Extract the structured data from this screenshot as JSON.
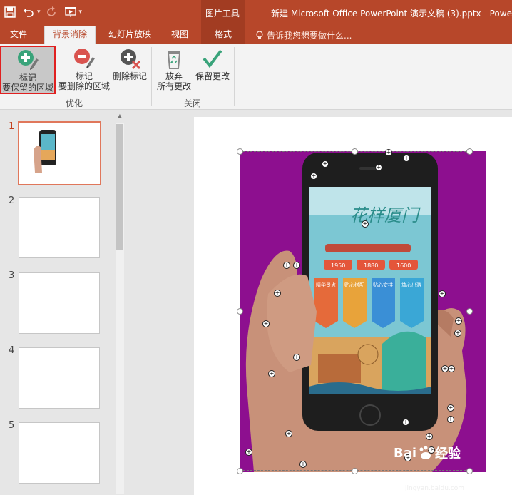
{
  "titlebar": {
    "context_group": "图片工具",
    "document_title": "新建 Microsoft Office PowerPoint 演示文稿 (3).pptx - Powe"
  },
  "tabs": [
    {
      "label": "文件"
    },
    {
      "label": "背景消除"
    },
    {
      "label": "幻灯片放映"
    },
    {
      "label": "视图"
    },
    {
      "label": "格式"
    }
  ],
  "tell_me": "告诉我您想要做什么...",
  "ribbon": {
    "mark_keep_line1": "标记",
    "mark_keep_line2": "要保留的区域",
    "mark_remove_line1": "标记",
    "mark_remove_line2": "要删除的区域",
    "delete_mark": "删除标记",
    "discard_line1": "放弃",
    "discard_line2": "所有更改",
    "keep_changes": "保留更改",
    "group_refine": "优化",
    "group_close": "关闭"
  },
  "slides": [
    {
      "number": "1"
    },
    {
      "number": "2"
    },
    {
      "number": "3"
    },
    {
      "number": "4"
    },
    {
      "number": "5"
    }
  ],
  "poster": {
    "title": "花样厦门",
    "prices": [
      "1950",
      "1880",
      "1600"
    ],
    "columns": [
      "精华景点",
      "贴心搭配",
      "贴心安排",
      "放心出游"
    ]
  },
  "watermark": {
    "brand_left": "Bai",
    "brand_right": "经验",
    "url": "jingyan.baidu.com"
  },
  "colors": {
    "accent": "#b7472a",
    "background_marked": "#8d0f8f"
  }
}
